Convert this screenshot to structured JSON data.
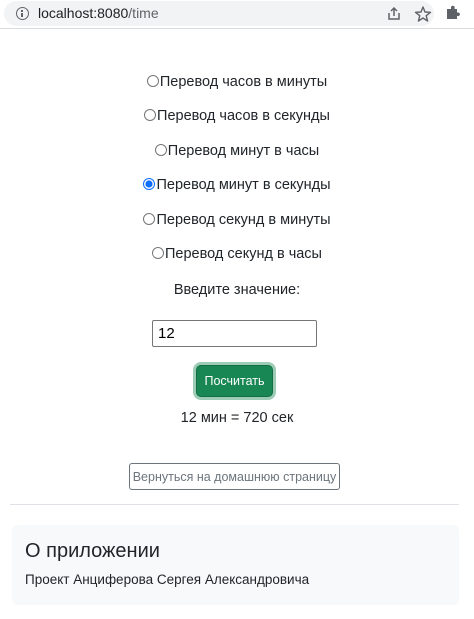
{
  "browser": {
    "url_host": "localhost:8080",
    "url_path": "/time",
    "icons": [
      "info-icon",
      "share-icon",
      "star-icon",
      "puzzle-extension-icon"
    ]
  },
  "form": {
    "options": [
      {
        "label": "Перевод часов в минуты",
        "checked": false
      },
      {
        "label": "Перевод часов в секунды",
        "checked": false
      },
      {
        "label": "Перевод минут в часы",
        "checked": false
      },
      {
        "label": "Перевод минут в секунды",
        "checked": true
      },
      {
        "label": "Перевод секунд в минуты",
        "checked": false
      },
      {
        "label": "Перевод секунд в часы",
        "checked": false
      }
    ],
    "prompt": "Введите значение:",
    "input_value": "12",
    "submit_label": "Посчитать",
    "result": "12 мин = 720 сек"
  },
  "home_button_label": "Вернуться на домашнюю страницу",
  "about": {
    "title": "О приложении",
    "text": "Проект Анциферова Сергея Александровича"
  },
  "colors": {
    "submit_bg": "#198754",
    "radio_accent": "#0d6efd",
    "card_bg": "#f8f9fa"
  }
}
